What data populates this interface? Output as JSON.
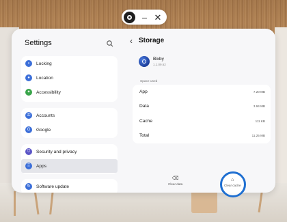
{
  "top_pill": {
    "minimize_glyph": "–",
    "close_glyph": "✕"
  },
  "sidebar": {
    "title": "Settings",
    "groups": [
      {
        "items": [
          {
            "label": "Locking",
            "color": "#3c6fd9",
            "icon": "lock-icon",
            "glyph": "🔒"
          },
          {
            "label": "Location",
            "color": "#3c6fd9",
            "icon": "location-pin-icon",
            "glyph": "●"
          },
          {
            "label": "Accessibility",
            "color": "#3aa54b",
            "icon": "accessibility-icon",
            "glyph": "♿"
          }
        ]
      },
      {
        "items": [
          {
            "label": "Accounts",
            "color": "#3c6fd9",
            "icon": "key-icon",
            "glyph": "⚿"
          },
          {
            "label": "Google",
            "color": "#3c6fd9",
            "icon": "google-icon",
            "glyph": "G"
          }
        ]
      },
      {
        "items": [
          {
            "label": "Security and privacy",
            "color": "#5b55c6",
            "icon": "shield-icon",
            "glyph": "⛉"
          },
          {
            "label": "Apps",
            "color": "#3c6fd9",
            "icon": "apps-grid-icon",
            "glyph": "⠿",
            "selected": true
          }
        ]
      },
      {
        "items": [
          {
            "label": "Software update",
            "color": "#3c6fd9",
            "icon": "update-icon",
            "glyph": "↻"
          }
        ]
      }
    ]
  },
  "content": {
    "title": "Storage",
    "app_name": "Bixby",
    "app_version": "1.1.09.62",
    "space_used_label": "Space used",
    "rows": [
      {
        "label": "App",
        "value": "7.20 MB"
      },
      {
        "label": "Data",
        "value": "3.94 MB"
      },
      {
        "label": "Cache",
        "value": "111 KB"
      },
      {
        "label": "Total",
        "value": "11.25 MB"
      }
    ],
    "clear_data_label": "Clear data",
    "clear_cache_label": "Clear cache"
  },
  "colors": {
    "accent": "#1f6fd1",
    "selected_bg": "#e4e5ea"
  }
}
